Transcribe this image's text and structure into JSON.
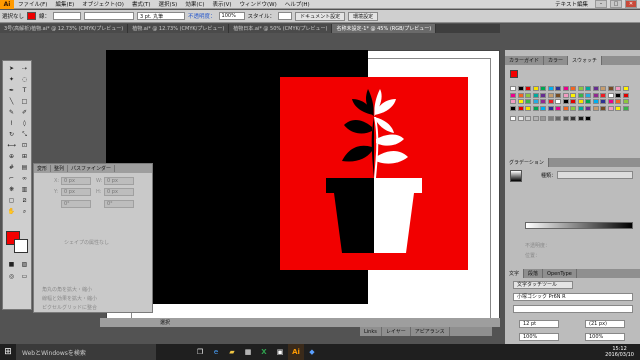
{
  "menubar": {
    "logo": "Ai",
    "items": [
      "ファイル(F)",
      "編集(E)",
      "オブジェクト(O)",
      "書式(T)",
      "選択(S)",
      "効果(C)",
      "表示(V)",
      "ウィンドウ(W)",
      "ヘルプ(H)"
    ],
    "workspace_label": "テキスト編集"
  },
  "controlbar": {
    "selection_label": "選択なし",
    "stroke_label": "線：",
    "stroke_weight": "3 pt. 丸筆",
    "opacity_label": "不透明度：",
    "opacity_value": "100%",
    "style_label": "スタイル：",
    "doc_setup_button": "ドキュメント設定",
    "prefs_button": "環境設定"
  },
  "tabs": [
    {
      "label": "3号(高解析)植物.ai* @ 12.73% (CMYK/プレビュー)",
      "active": false
    },
    {
      "label": "植物.ai* @ 12.73% (CMYK/プレビュー)",
      "active": false
    },
    {
      "label": "植物日本.ai* @ 50% (CMYK/プレビュー)",
      "active": false
    },
    {
      "label": "名称未設定-1* @ 45% (RGB/プレビュー)",
      "active": true
    }
  ],
  "props_panel": {
    "tabs": [
      "変形",
      "整列",
      "パスファインダー"
    ],
    "x_label": "X:",
    "x_value": "0 px",
    "y_label": "Y:",
    "y_value": "0 px",
    "w_label": "W:",
    "w_value": "0 px",
    "h_label": "H:",
    "h_value": "0 px",
    "angle_value": "0°",
    "shear_value": "0°",
    "no_shape": "シェイプの属性なし",
    "opt1": "角丸の角を拡大・縮小",
    "opt2": "線幅と効果を拡大・縮小",
    "opt3": "ピクセルグリッドに整合"
  },
  "right_panel": {
    "swatch_tabs": [
      "カラーガイド",
      "カラー",
      "スウォッチ"
    ],
    "gradient_tabs": [
      "グラデーション"
    ],
    "gradient_type_label": "種類：",
    "opacity_label": "不透明度：",
    "position_label": "位置：",
    "char_tabs": [
      "文字",
      "段落",
      "OpenType"
    ],
    "touch_type_button": "文字タッチツール",
    "font_name": "小塚ゴシック Pr6N R",
    "font_size": "12 pt",
    "leading": "(21 px)",
    "tracking": "100%",
    "kerning": "100%"
  },
  "layers_tabs": [
    "Links",
    "レイヤー",
    "アピアランス"
  ],
  "status": {
    "label": "選択"
  },
  "taskbar": {
    "search_placeholder": "WebとWindowsを検索",
    "time": "15:12",
    "date": "2016/03/10"
  },
  "colors": {
    "accent_red": "#f20000",
    "artwork_black": "#000000",
    "artwork_white": "#ffffff"
  }
}
